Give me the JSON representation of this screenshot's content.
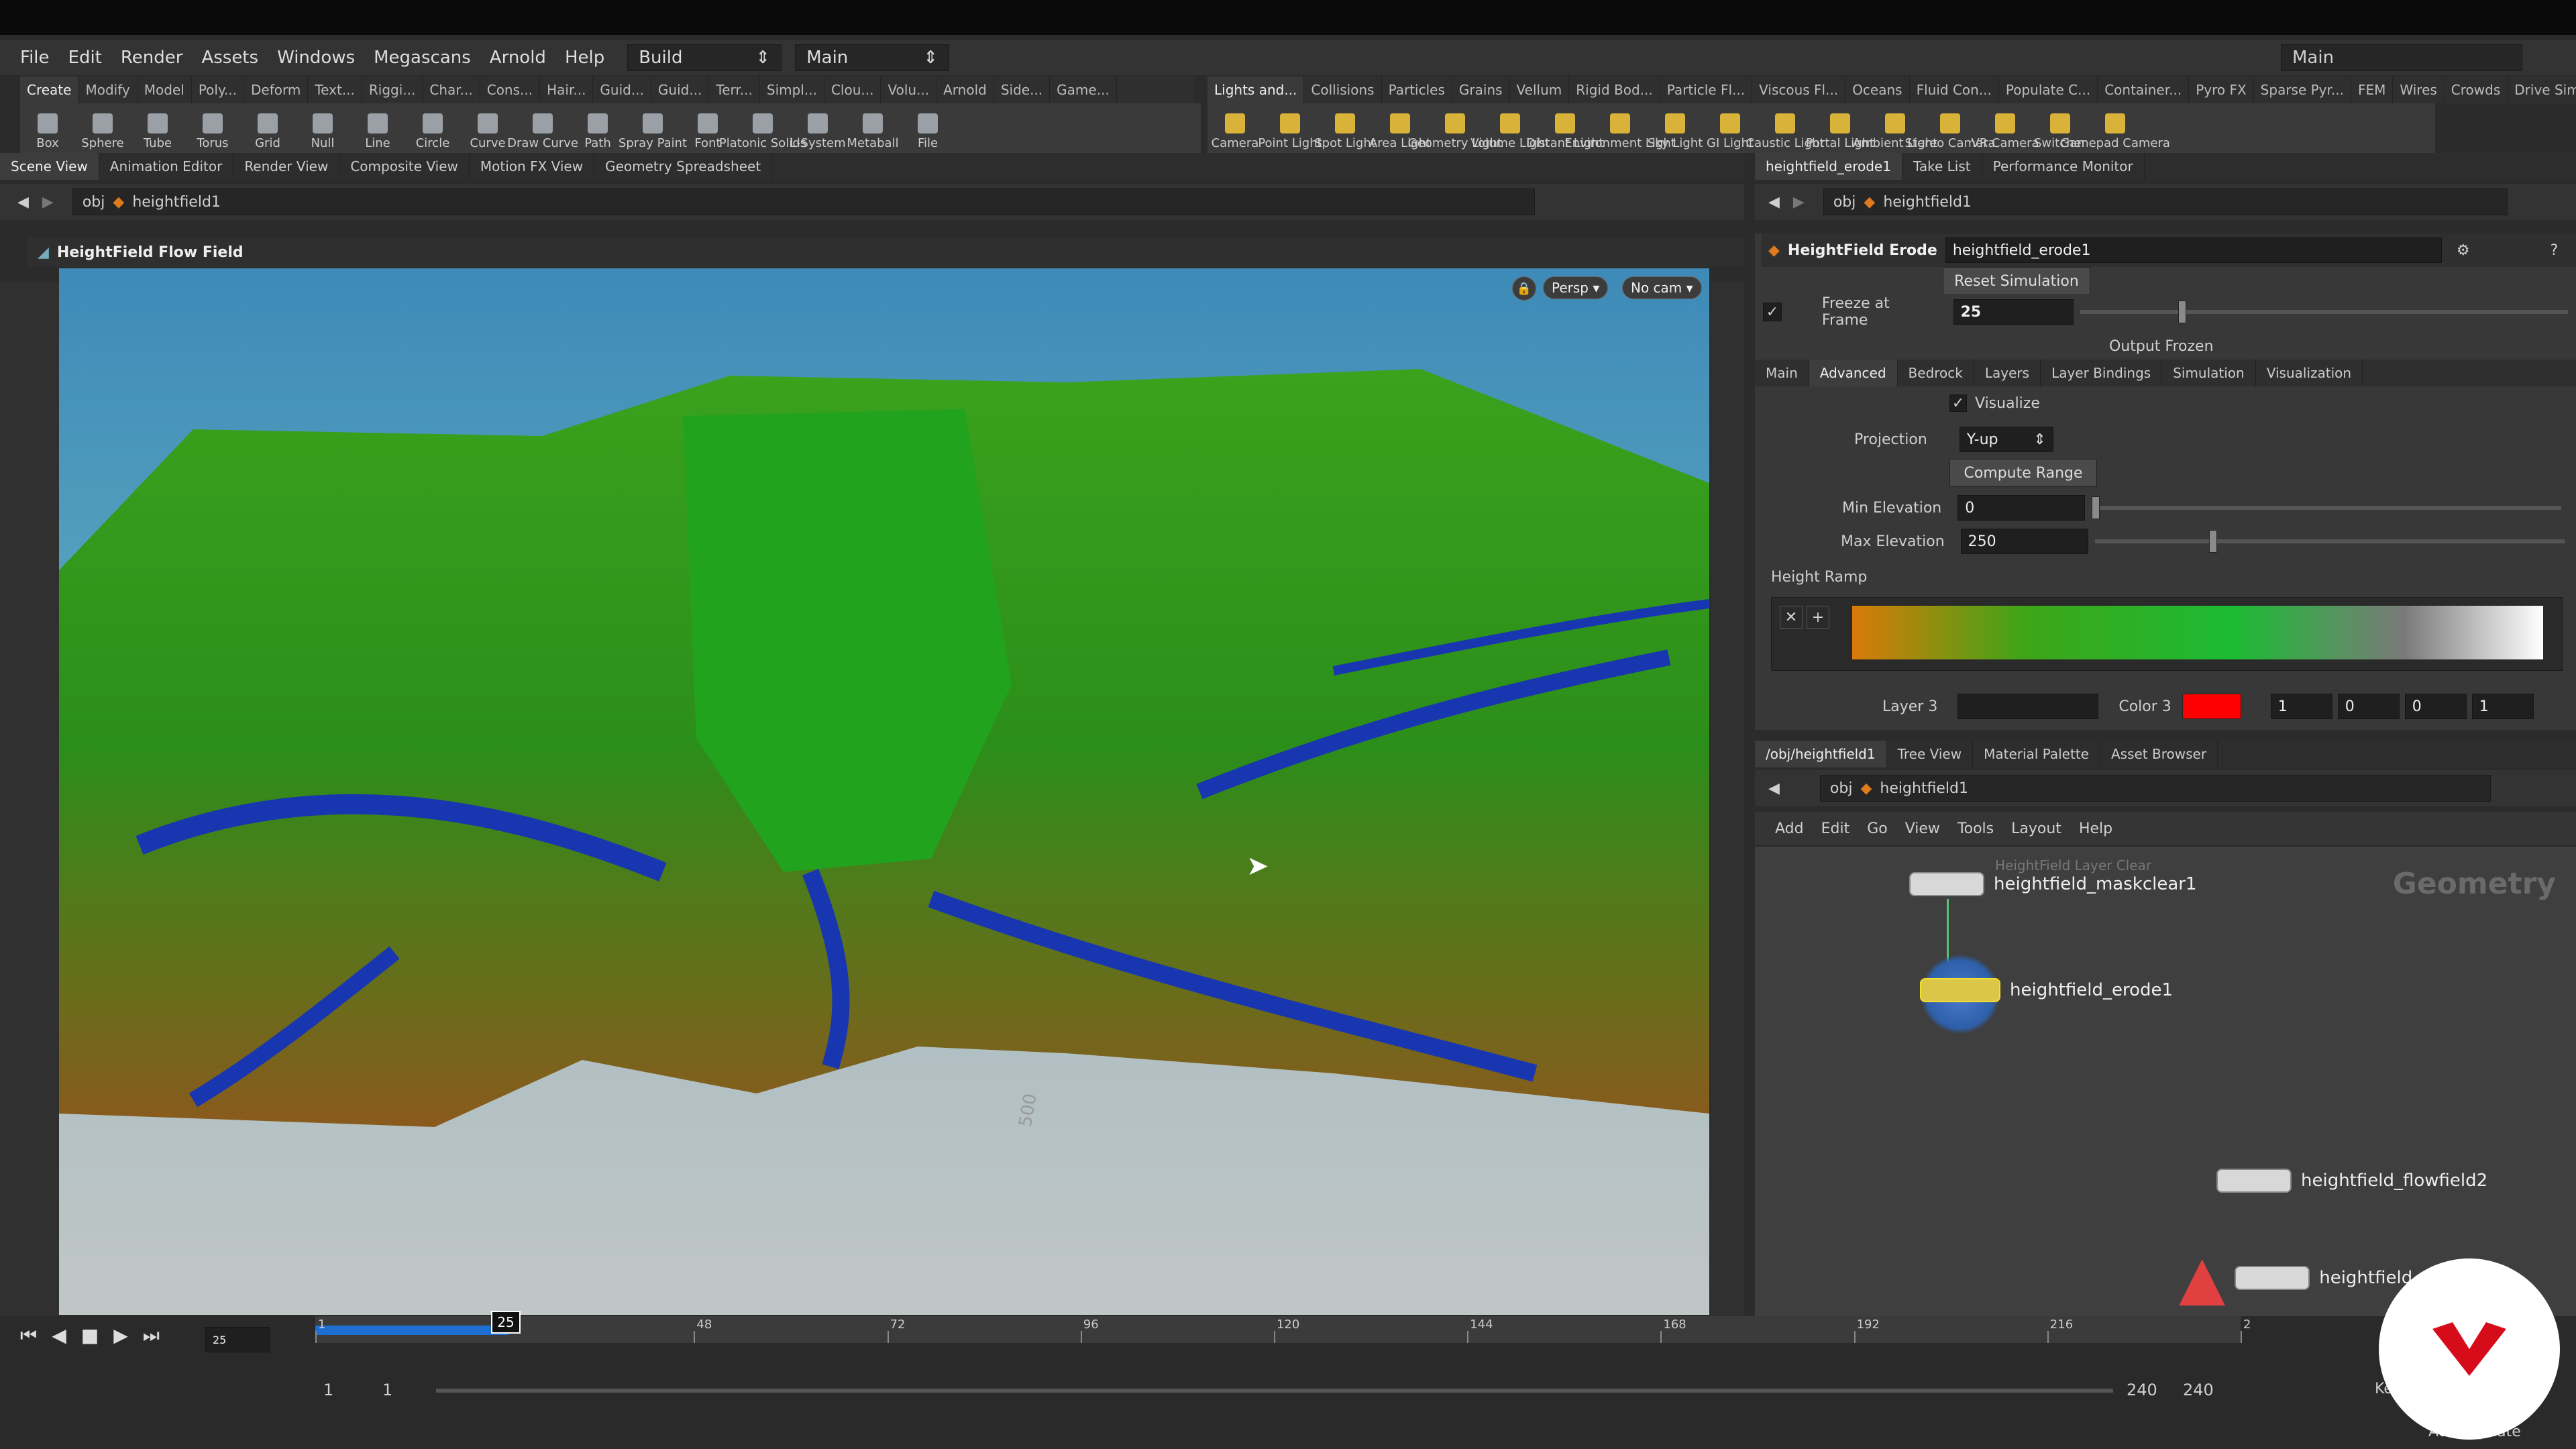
{
  "menu": {
    "items": [
      "File",
      "Edit",
      "Render",
      "Assets",
      "Windows",
      "Megascans",
      "Arnold",
      "Help"
    ],
    "desktop": "Build",
    "network_desktop": "Main",
    "right_desktop": "Main"
  },
  "shelf_tabs_left": [
    "Create",
    "Modify",
    "Model",
    "Poly...",
    "Deform",
    "Text...",
    "Riggi...",
    "Char...",
    "Cons...",
    "Hair...",
    "Guid...",
    "Guid...",
    "Terr...",
    "Simpl...",
    "Clou...",
    "Volu...",
    "Arnold",
    "Side...",
    "Game..."
  ],
  "shelf_tools_left": [
    "Box",
    "Sphere",
    "Tube",
    "Torus",
    "Grid",
    "Null",
    "Line",
    "Circle",
    "Curve",
    "Draw Curve",
    "Path",
    "Spray Paint",
    "Font",
    "Platonic Solids",
    "L-System",
    "Metaball",
    "File"
  ],
  "shelf_tabs_right": [
    "Lights and...",
    "Collisions",
    "Particles",
    "Grains",
    "Vellum",
    "Rigid Bod...",
    "Particle Fl...",
    "Viscous Fl...",
    "Oceans",
    "Fluid Con...",
    "Populate C...",
    "Container...",
    "Pyro FX",
    "Sparse Pyr...",
    "FEM",
    "Wires",
    "Crowds",
    "Drive Sim..."
  ],
  "shelf_tools_right": [
    "Camera",
    "Point Light",
    "Spot Light",
    "Area Light",
    "Geometry Light",
    "Volume Light",
    "Distant Light",
    "Environment Light",
    "Sky Light",
    "GI Light",
    "Caustic Light",
    "Portal Light",
    "Ambient Light",
    "Stereo Camera",
    "VR Camera",
    "Switcher",
    "Gamepad Camera"
  ],
  "pane_tabs_left": [
    "Scene View",
    "Animation Editor",
    "Render View",
    "Composite View",
    "Motion FX View",
    "Geometry Spreadsheet"
  ],
  "pane_tabs_param": [
    "heightfield_erode1",
    "Take List",
    "Performance Monitor"
  ],
  "pane_tabs_network": [
    "/obj/heightfield1",
    "Tree View",
    "Material Palette",
    "Asset Browser"
  ],
  "path": {
    "obj": "obj",
    "node": "heightfield1"
  },
  "viewport": {
    "title": "HeightField Flow Field",
    "persp": "Persp ▾",
    "cam": "No cam ▾",
    "grid_label": "500"
  },
  "params": {
    "node_type": "HeightField Erode",
    "node_name": "heightfield_erode1",
    "reset_button": "Reset Simulation",
    "freeze_label": "Freeze at Frame",
    "freeze_value": "25",
    "freeze_level": 0.2,
    "status": "Output Frozen",
    "tabs": [
      "Main",
      "Advanced",
      "Bedrock",
      "Layers",
      "Layer Bindings",
      "Simulation",
      "Visualization"
    ],
    "visualize_label": "Visualize",
    "projection_label": "Projection",
    "projection_value": "Y-up",
    "compute_range": "Compute Range",
    "min_elev_label": "Min Elevation",
    "min_elev_value": "0",
    "max_elev_label": "Max Elevation",
    "max_elev_value": "250",
    "ramp_label": "Height Ramp",
    "layer_label": "Layer 3",
    "color_label": "Color 3",
    "color_values": [
      "1",
      "0",
      "0",
      "1"
    ]
  },
  "network": {
    "menu": [
      "Add",
      "Edit",
      "Go",
      "View",
      "Tools",
      "Layout",
      "Help"
    ],
    "context_label": "Geometry",
    "nodes": [
      {
        "type_label": "HeightField Layer Clear",
        "name": "heightfield_maskclear1"
      },
      {
        "name": "heightfield_erode1"
      },
      {
        "name": "heightfield_flowfield2"
      },
      {
        "name": "heightfield_sl"
      }
    ]
  },
  "timeline": {
    "current_frame": "25",
    "ticks": [
      "1",
      "48",
      "72",
      "96",
      "120",
      "144",
      "168",
      "192",
      "216",
      "2"
    ],
    "start": "1",
    "start2": "1",
    "end": "240",
    "end2": "240",
    "key_label": "Key",
    "auto_update": "Auto Update"
  },
  "colors": {
    "accent": "#1d6fd1",
    "color3": "#ff0000"
  }
}
